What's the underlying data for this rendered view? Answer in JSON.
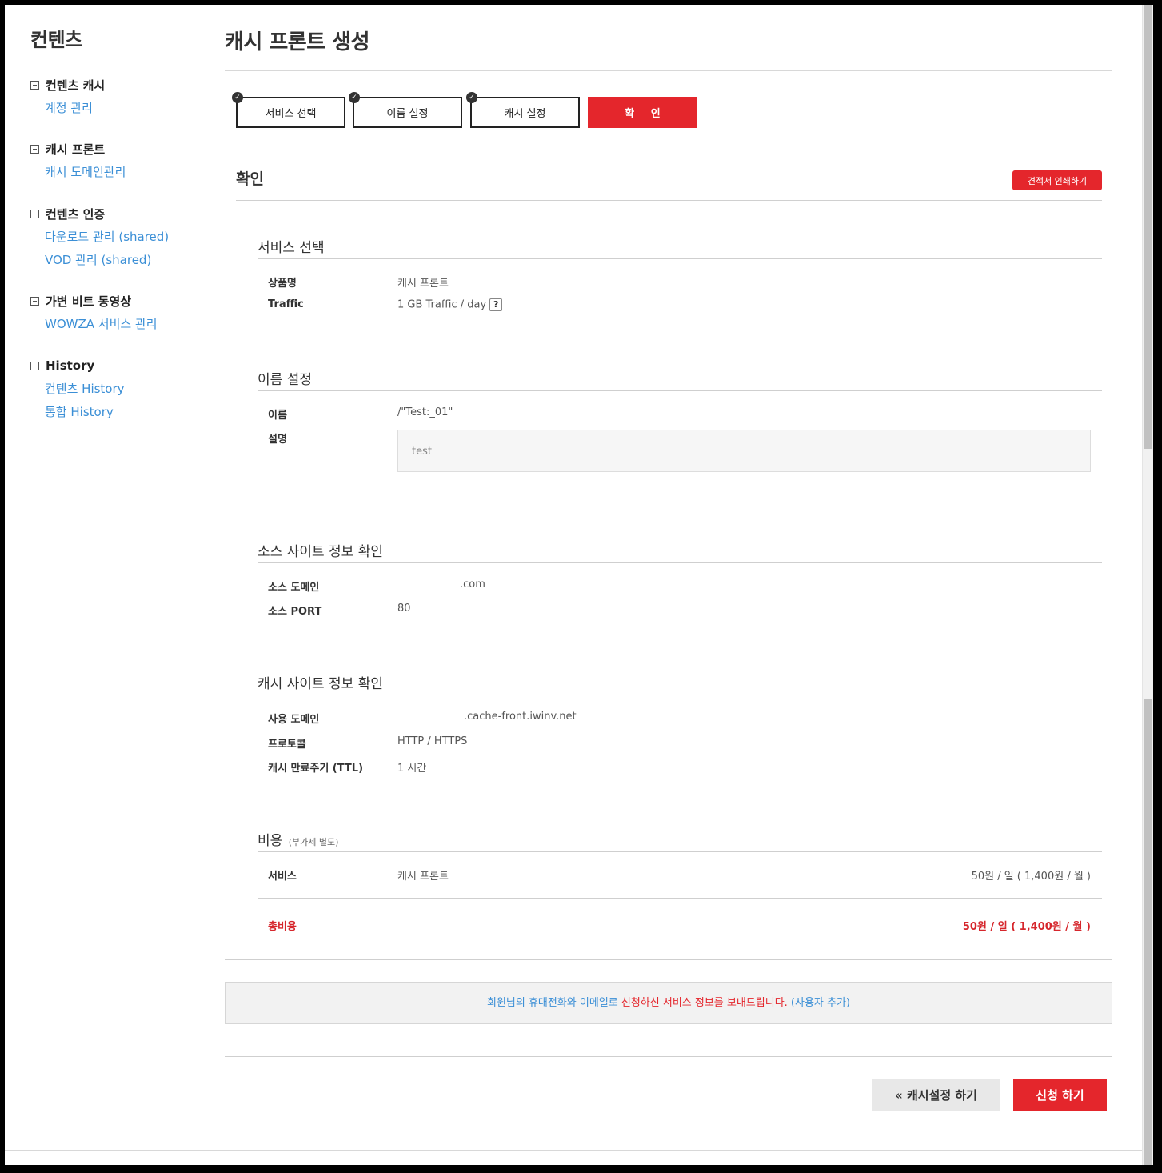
{
  "sidebar": {
    "title": "컨텐츠",
    "groups": [
      {
        "label": "컨텐츠 캐시",
        "items": [
          "계정 관리"
        ]
      },
      {
        "label": "캐시 프론트",
        "items": [
          "캐시 도메인관리"
        ]
      },
      {
        "label": "컨텐츠 인증",
        "items": [
          "다운로드 관리 (shared)",
          "VOD 관리 (shared)"
        ]
      },
      {
        "label": "가변 비트 동영상",
        "items": [
          "WOWZA 서비스 관리"
        ]
      },
      {
        "label": "History",
        "items": [
          "컨텐츠 History",
          "통합 History"
        ]
      }
    ]
  },
  "page": {
    "title": "캐시 프론트 생성"
  },
  "steps": [
    {
      "label": "서비스 선택",
      "done": true
    },
    {
      "label": "이름 설정",
      "done": true
    },
    {
      "label": "캐시 설정",
      "done": true
    },
    {
      "label": "확 인",
      "done": false
    }
  ],
  "confirm": {
    "title": "확인",
    "print_label": "견적서 인쇄하기"
  },
  "service": {
    "title": "서비스 선택",
    "product_label": "상품명",
    "product_value": "캐시 프론트",
    "traffic_label": "Traffic",
    "traffic_value": "1 GB Traffic / day",
    "help_glyph": "?"
  },
  "name": {
    "title": "이름 설정",
    "name_label": "이름",
    "name_value": "/\"Test:_01\"",
    "desc_label": "설명",
    "desc_value": "test"
  },
  "source": {
    "title": "소스 사이트 정보 확인",
    "domain_label": "소스 도메인",
    "domain_value": ".com",
    "port_label": "소스 PORT",
    "port_value": "80"
  },
  "cache": {
    "title": "캐시 사이트 정보 확인",
    "domain_label": "사용 도메인",
    "domain_value": ".cache-front.iwinv.net",
    "protocol_label": "프로토콜",
    "protocol_value": "HTTP / HTTPS",
    "ttl_label": "캐시 만료주기 (TTL)",
    "ttl_value": "1 시간"
  },
  "cost": {
    "title": "비용",
    "subtitle": "(부가세 별도)",
    "service_label": "서비스",
    "service_name": "캐시 프론트",
    "service_price": "50원 / 일 ( 1,400원 / 월 )",
    "total_label": "총비용",
    "total_price": "50원 / 일 ( 1,400원 / 월 )"
  },
  "notice": {
    "part1": "회원님의 휴대전화와 이메일로 ",
    "part2": "신청하신 서비스 정보를 보내드립니다.",
    "link": " (사용자 추가)"
  },
  "actions": {
    "back_label": "« 캐시설정 하기",
    "submit_label": "신청 하기"
  },
  "colors": {
    "accent": "#e4262c",
    "link": "#3b8fd6"
  }
}
